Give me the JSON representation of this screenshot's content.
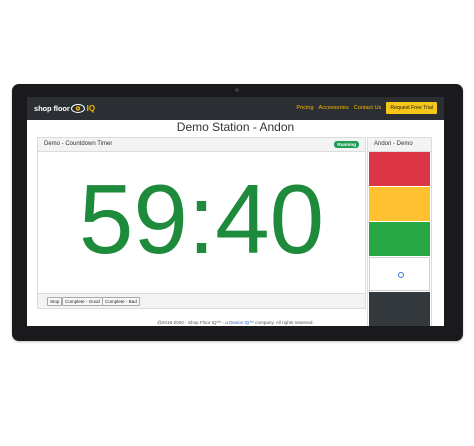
{
  "navbar": {
    "brand_text": "shop floor",
    "brand_iq": "IQ",
    "links": [
      "Pricing",
      "Accessories",
      "Contact Us"
    ],
    "trial_button": "Request Free Trial"
  },
  "page": {
    "title": "Demo Station - Andon"
  },
  "timer": {
    "title": "Demo - Countdown Timer",
    "status": "Running",
    "value": "59:40",
    "buttons": [
      "Stop",
      "Complete - Good",
      "Complete - Bad"
    ]
  },
  "andon": {
    "title": "Andon - Demo",
    "lights": [
      {
        "name": "red",
        "color": "#dc3545"
      },
      {
        "name": "yellow",
        "color": "#ffc12f"
      },
      {
        "name": "green",
        "color": "#28a745"
      },
      {
        "name": "white",
        "color": "#ffffff"
      },
      {
        "name": "dark",
        "color": "#33383d"
      }
    ]
  },
  "footer": {
    "prefix": "@2018-2020 - Shop Floor IQ™ - a ",
    "link": "Device IQ™",
    "suffix": " company. All rights reserved."
  }
}
